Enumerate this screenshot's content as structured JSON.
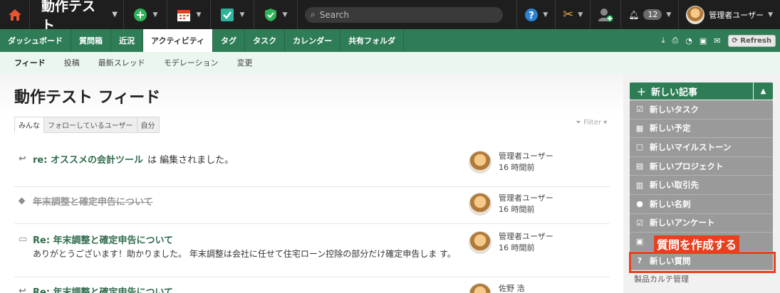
{
  "topbar": {
    "title": "動作テスト",
    "search_placeholder": "Search",
    "notification_count": "12",
    "user_name": "管理者ユーザー"
  },
  "nav": {
    "tabs": [
      "ダッシュボード",
      "質問箱",
      "近況",
      "アクティビティ",
      "タグ",
      "タスク",
      "カレンダー",
      "共有フォルダ"
    ],
    "active": "アクティビティ",
    "refresh_label": "Refresh"
  },
  "subnav": {
    "items": [
      "フィード",
      "投稿",
      "最新スレッド",
      "モデレーション",
      "変更"
    ]
  },
  "main": {
    "title": "動作テスト フィード",
    "filter_tabs": [
      "みんな",
      "フォローしているユーザー",
      "自分"
    ],
    "filter_label": "Filter"
  },
  "feed": [
    {
      "title": "re: オススメの会計ツール",
      "suffix": "は 編集されました。",
      "body": "",
      "user": "管理者ユーザー",
      "time": "16 時間前"
    },
    {
      "title": "年末調整と確定申告について",
      "suffix": "",
      "body": "",
      "user": "管理者ユーザー",
      "time": "16 時間前"
    },
    {
      "title": "Re: 年末調整と確定申告について",
      "suffix": "",
      "body": "ありがとうございます！助かりました。 年末調整は会社に任せて住宅ローン控除の部分だけ確定申告しま す。",
      "user": "管理者ユーザー",
      "time": "16 時間前"
    },
    {
      "title": "Re: 年末調整と確定申告について",
      "suffix": "",
      "body": "",
      "user": "佐野 浩",
      "time": ""
    }
  ],
  "sidebar": {
    "new_post_label": "新しい記事",
    "menu": [
      "新しいタスク",
      "新しい予定",
      "新しいマイルストーン",
      "新しいプロジェクト",
      "新しい取引先",
      "新しい名刺",
      "新しいアンケート",
      "",
      "新しい質問"
    ],
    "annotation": "質問を作成する",
    "below_text": "製品カルテ管理"
  },
  "colors": {
    "accent": "#2f7d57",
    "highlight": "#e5411f"
  }
}
